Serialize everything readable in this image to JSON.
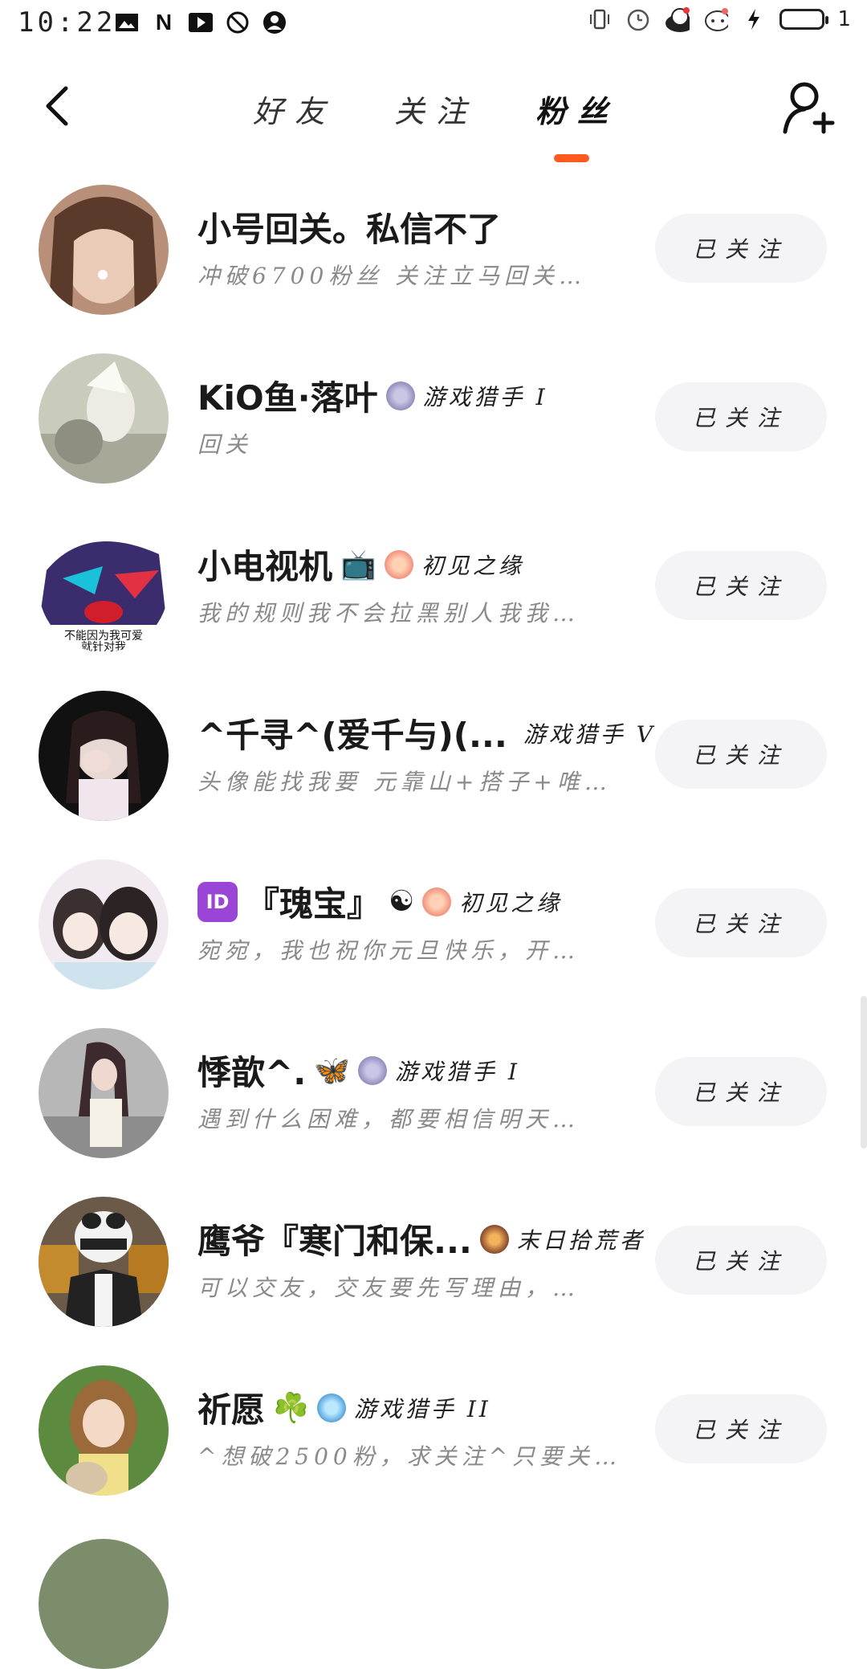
{
  "status_bar": {
    "time": "10:22",
    "battery_level": "1"
  },
  "header": {
    "tabs": [
      {
        "label": "好友",
        "active": false
      },
      {
        "label": "关注",
        "active": false
      },
      {
        "label": "粉丝",
        "active": true
      }
    ]
  },
  "colors": {
    "accent": "#ff5a1f",
    "button_bg": "#f4f4f6",
    "subtitle": "#8a8a8a"
  },
  "fans": [
    {
      "name": "小号回关。私信不了",
      "prefix_icon": "",
      "suffix_emoji": "",
      "badge_icon": "",
      "badge_text": "",
      "subtitle": "冲破6700粉丝 关注立马回关…",
      "button": "已关注"
    },
    {
      "name": "KiO鱼·落叶",
      "prefix_icon": "",
      "suffix_emoji": "",
      "badge_icon": "game-hunter-icon",
      "badge_text": "游戏猎手 I",
      "subtitle": "回关",
      "button": "已关注"
    },
    {
      "name": "小电视机",
      "prefix_icon": "",
      "suffix_emoji": "📺",
      "badge_icon": "first-meet-icon",
      "badge_text": "初见之缘",
      "subtitle": "我的规则我不会拉黑别人我我…",
      "button": "已关注"
    },
    {
      "name": "^千寻^(爱千与)(...",
      "prefix_icon": "",
      "suffix_emoji": "",
      "badge_icon": "game-hunter-icon",
      "badge_text": "游戏猎手 V",
      "subtitle": "头像能找我要 元靠山+搭子+唯…",
      "button": "已关注"
    },
    {
      "name": "『瑰宝』",
      "prefix_icon": "ID",
      "suffix_emoji": "☯",
      "badge_icon": "first-meet-icon",
      "badge_text": "初见之缘",
      "subtitle": "宛宛，我也祝你元旦快乐，开…",
      "button": "已关注"
    },
    {
      "name": "悸歆^.",
      "prefix_icon": "",
      "suffix_emoji": "🦋",
      "badge_icon": "game-hunter-icon",
      "badge_text": "游戏猎手 I",
      "subtitle": "遇到什么困难，都要相信明天…",
      "button": "已关注"
    },
    {
      "name": "鹰爷『寒门和保...",
      "prefix_icon": "",
      "suffix_emoji": "",
      "badge_icon": "doomsday-scavenger-icon",
      "badge_text": "末日拾荒者",
      "subtitle": "可以交友，交友要先写理由，…",
      "button": "已关注"
    },
    {
      "name": "祈愿",
      "prefix_icon": "",
      "suffix_emoji": "☘️",
      "badge_icon": "game-hunter-icon",
      "badge_text": "游戏猎手 II",
      "subtitle": "^想破2500粉，求关注^只要关…",
      "button": "已关注"
    }
  ]
}
